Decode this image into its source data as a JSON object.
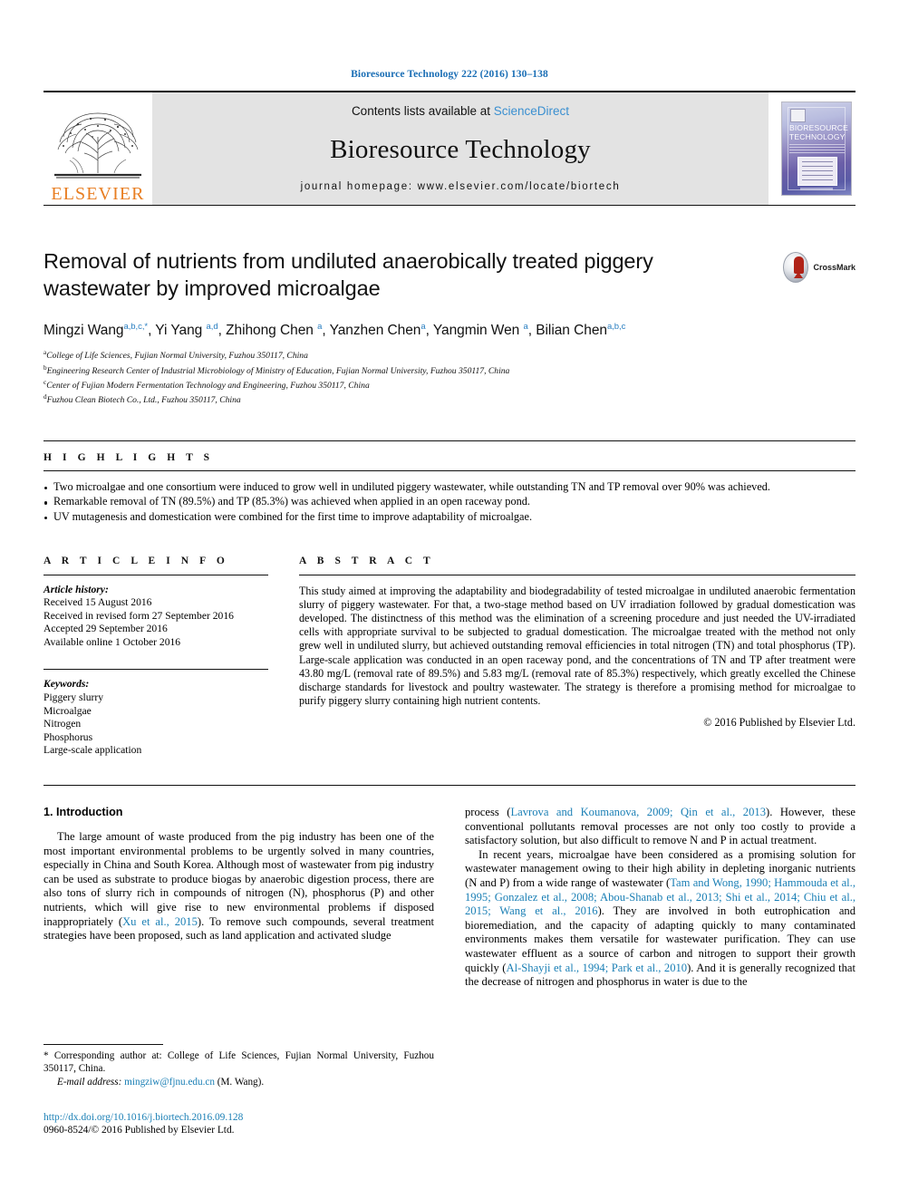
{
  "running_head": "Bioresource Technology 222 (2016) 130–138",
  "masthead": {
    "publisher_logo_label": "ELSEVIER",
    "contents_prefix": "Contents lists available at ",
    "contents_link": "ScienceDirect",
    "journal_title": "Bioresource Technology",
    "homepage": "journal homepage: www.elsevier.com/locate/biortech",
    "cover_title_line1": "BIORESOURCE",
    "cover_title_line2": "TECHNOLOGY"
  },
  "article": {
    "title": "Removal of nutrients from undiluted anaerobically treated piggery wastewater by improved microalgae",
    "crossmark_label": "CrossMark",
    "authors": [
      {
        "name": "Mingzi Wang",
        "sup": "a,b,c,",
        "star": "*",
        "sep": ", "
      },
      {
        "name": "Yi Yang ",
        "sup": "a,d",
        "star": "",
        "sep": ", "
      },
      {
        "name": "Zhihong Chen ",
        "sup": "a",
        "star": "",
        "sep": ", "
      },
      {
        "name": "Yanzhen Chen",
        "sup": "a",
        "star": "",
        "sep": ", "
      },
      {
        "name": "Yangmin Wen ",
        "sup": "a",
        "star": "",
        "sep": ", "
      },
      {
        "name": "Bilian Chen",
        "sup": "a,b,c",
        "star": "",
        "sep": ""
      }
    ],
    "affiliations": [
      {
        "mark": "a",
        "text": "College of Life Sciences, Fujian Normal University, Fuzhou 350117, China"
      },
      {
        "mark": "b",
        "text": "Engineering Research Center of Industrial Microbiology of Ministry of Education, Fujian Normal University, Fuzhou 350117, China"
      },
      {
        "mark": "c",
        "text": "Center of Fujian Modern Fermentation Technology and Engineering, Fuzhou 350117, China"
      },
      {
        "mark": "d",
        "text": "Fuzhou Clean Biotech Co., Ltd., Fuzhou 350117, China"
      }
    ]
  },
  "highlights": {
    "heading": "H I G H L I G H T S",
    "items": [
      "Two microalgae and one consortium were induced to grow well in undiluted piggery wastewater, while outstanding TN and TP removal over 90% was achieved.",
      "Remarkable removal of TN (89.5%) and TP (85.3%) was achieved when applied in an open raceway pond.",
      "UV mutagenesis and domestication were combined for the first time to improve adaptability of microalgae."
    ]
  },
  "article_info": {
    "heading": "A R T I C L E   I N F O",
    "history_label": "Article history:",
    "history": [
      "Received 15 August 2016",
      "Received in revised form 27 September 2016",
      "Accepted 29 September 2016",
      "Available online 1 October 2016"
    ],
    "keywords_label": "Keywords:",
    "keywords": [
      "Piggery slurry",
      "Microalgae",
      "Nitrogen",
      "Phosphorus",
      "Large-scale application"
    ]
  },
  "abstract": {
    "heading": "A B S T R A C T",
    "text": "This study aimed at improving the adaptability and biodegradability of tested microalgae in undiluted anaerobic fermentation slurry of piggery wastewater. For that, a two-stage method based on UV irradiation followed by gradual domestication was developed. The distinctness of this method was the elimination of a screening procedure and just needed the UV-irradiated cells with appropriate survival to be subjected to gradual domestication. The microalgae treated with the method not only grew well in undiluted slurry, but achieved outstanding removal efficiencies in total nitrogen (TN) and total phosphorus (TP). Large-scale application was conducted in an open raceway pond, and the concentrations of TN and TP after treatment were 43.80 mg/L (removal rate of 89.5%) and 5.83 mg/L (removal rate of 85.3%) respectively, which greatly excelled the Chinese discharge standards for livestock and poultry wastewater. The strategy is therefore a promising method for microalgae to purify piggery slurry containing high nutrient contents.",
    "copyright": "© 2016 Published by Elsevier Ltd."
  },
  "body": {
    "section_number_title": "1. Introduction",
    "left_paragraph_1": "The large amount of waste produced from the pig industry has been one of the most important environmental problems to be urgently solved in many countries, especially in China and South Korea. Although most of wastewater from pig industry can be used as substrate to produce biogas by anaerobic digestion process, there are also tons of slurry rich in compounds of nitrogen (N), phosphorus (P) and other nutrients, which will give rise to new environmental problems if disposed inappropriately (",
    "left_ref_1": "Xu et al., 2015",
    "left_paragraph_1_tail": "). To remove such compounds, several treatment strategies have been proposed, such as land application and activated sludge",
    "right_paragraph_1_head": "process (",
    "right_ref_1": "Lavrova and Koumanova, 2009; Qin et al., 2013",
    "right_paragraph_1_tail": "). However, these conventional pollutants removal processes are not only too costly to provide a satisfactory solution, but also difficult to remove N and P in actual treatment.",
    "right_paragraph_2_head": "In recent years, microalgae have been considered as a promising solution for wastewater management owing to their high ability in depleting inorganic nutrients (N and P) from a wide range of wastewater (",
    "right_ref_2": "Tam and Wong, 1990; Hammouda et al., 1995; Gonzalez et al., 2008; Abou-Shanab et al., 2013; Shi et al., 2014; Chiu et al., 2015; Wang et al., 2016",
    "right_paragraph_2_mid": "). They are involved in both eutrophication and bioremediation, and the capacity of adapting quickly to many contaminated environments makes them versatile for wastewater purification. They can use wastewater effluent as a source of carbon and nitrogen to support their growth quickly (",
    "right_ref_3": "Al-Shayji et al., 1994; Park et al., 2010",
    "right_paragraph_2_tail": "). And it is generally recognized that the decrease of nitrogen and phosphorus in water is due to the"
  },
  "footnote": {
    "corresponding": "* Corresponding author at: College of Life Sciences, Fujian Normal University, Fuzhou 350117, China.",
    "email_label": "E-mail address:",
    "email": "mingziw@fjnu.edu.cn",
    "email_suffix": "(M. Wang).",
    "doi": "http://dx.doi.org/10.1016/j.biortech.2016.09.128",
    "issn": "0960-8524/© 2016 Published by Elsevier Ltd."
  },
  "colors": {
    "link_blue": "#1a7fb5",
    "sciencedirect_blue": "#3a8fd0",
    "elsevier_orange": "#E87E22",
    "crossmark_red": "#b02318"
  }
}
